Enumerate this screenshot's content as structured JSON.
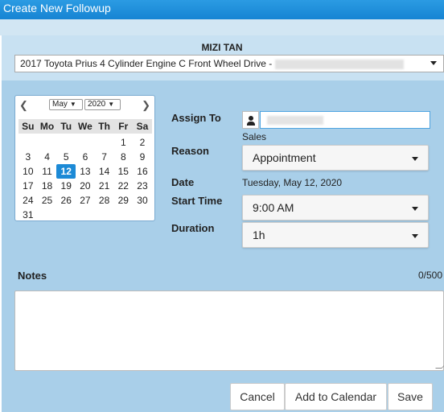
{
  "window": {
    "title": "Create New Followup"
  },
  "customer": {
    "name": "MIZI TAN"
  },
  "vehicle": {
    "selected": "2017 Toyota Prius 4 Cylinder Engine C Front Wheel Drive -"
  },
  "calendar": {
    "month": "May",
    "year": "2020",
    "weekdays": [
      "Su",
      "Mo",
      "Tu",
      "We",
      "Th",
      "Fr",
      "Sa"
    ],
    "weeks": [
      [
        "",
        "",
        "",
        "",
        "",
        "1",
        "2"
      ],
      [
        "3",
        "4",
        "5",
        "6",
        "7",
        "8",
        "9"
      ],
      [
        "10",
        "11",
        "12",
        "13",
        "14",
        "15",
        "16"
      ],
      [
        "17",
        "18",
        "19",
        "20",
        "21",
        "22",
        "23"
      ],
      [
        "24",
        "25",
        "26",
        "27",
        "28",
        "29",
        "30"
      ],
      [
        "31",
        "",
        "",
        "",
        "",
        "",
        ""
      ]
    ],
    "selected_day": "12"
  },
  "form": {
    "assign_to_label": "Assign To",
    "assign_department": "Sales",
    "reason_label": "Reason",
    "reason_value": "Appointment",
    "date_label": "Date",
    "date_value": "Tuesday, May 12, 2020",
    "start_time_label": "Start Time",
    "start_time_value": "9:00 AM",
    "duration_label": "Duration",
    "duration_value": "1h",
    "notes_label": "Notes",
    "notes_count": "0/500",
    "notes_value": ""
  },
  "buttons": {
    "cancel": "Cancel",
    "add_to_calendar": "Add to Calendar",
    "save": "Save"
  },
  "icons": {
    "assign": "user-icon",
    "prev": "chevron-left-icon",
    "next": "chevron-right-icon"
  },
  "colors": {
    "title_bar": "#1a88d6",
    "panel": "#a9cfe9",
    "selected_day": "#1c8ad6"
  }
}
